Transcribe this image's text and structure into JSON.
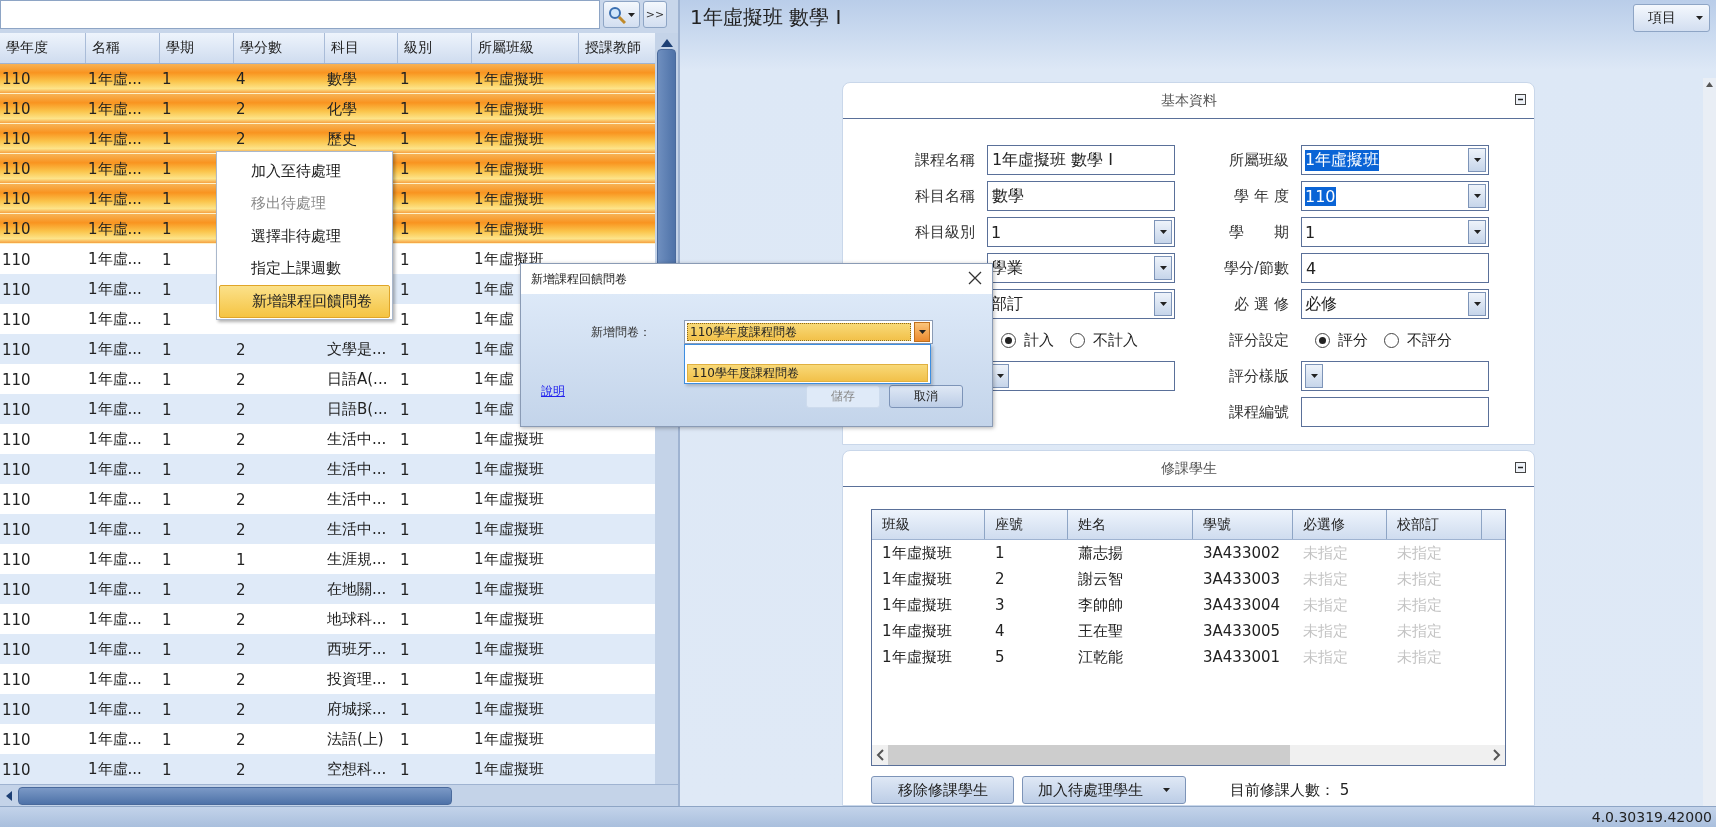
{
  "search": {
    "more_button": ">>"
  },
  "course_table": {
    "columns": [
      "學年度",
      "名稱",
      "學期",
      "學分數",
      "科目",
      "級別",
      "所屬班級",
      "授課教師"
    ],
    "rows": [
      {
        "year": "110",
        "name": "1年虛...",
        "term": "1",
        "credits": "4",
        "subject": "數學",
        "level": "1",
        "class": "1年虛擬班",
        "selected": true
      },
      {
        "year": "110",
        "name": "1年虛...",
        "term": "1",
        "credits": "2",
        "subject": "化學",
        "level": "1",
        "class": "1年虛擬班",
        "selected": true
      },
      {
        "year": "110",
        "name": "1年虛...",
        "term": "1",
        "credits": "2",
        "subject": "歷史",
        "level": "1",
        "class": "1年虛擬班",
        "selected": true
      },
      {
        "year": "110",
        "name": "1年虛...",
        "term": "1",
        "level": "1",
        "class": "1年虛擬班",
        "selected": true
      },
      {
        "year": "110",
        "name": "1年虛...",
        "term": "1",
        "level": "1",
        "class": "1年虛擬班",
        "selected": true
      },
      {
        "year": "110",
        "name": "1年虛...",
        "term": "1",
        "level": "1",
        "class": "1年虛擬班",
        "selected": true
      },
      {
        "year": "110",
        "name": "1年虛...",
        "term": "1",
        "level": "1",
        "class": "1年虛擬班",
        "selected": false
      },
      {
        "year": "110",
        "name": "1年虛...",
        "term": "1",
        "level": "1",
        "class": "1年虛",
        "selected": false
      },
      {
        "year": "110",
        "name": "1年虛...",
        "term": "1",
        "level": "1",
        "class": "1年虛",
        "selected": false
      },
      {
        "year": "110",
        "name": "1年虛...",
        "term": "1",
        "credits": "2",
        "subject": "文學是...",
        "level": "1",
        "class": "1年虛",
        "selected": false
      },
      {
        "year": "110",
        "name": "1年虛...",
        "term": "1",
        "credits": "2",
        "subject": "日語A(...",
        "level": "1",
        "class": "1年虛",
        "selected": false
      },
      {
        "year": "110",
        "name": "1年虛...",
        "term": "1",
        "credits": "2",
        "subject": "日語B(...",
        "level": "1",
        "class": "1年虛",
        "selected": false
      },
      {
        "year": "110",
        "name": "1年虛...",
        "term": "1",
        "credits": "2",
        "subject": "生活中...",
        "level": "1",
        "class": "1年虛擬班",
        "selected": false
      },
      {
        "year": "110",
        "name": "1年虛...",
        "term": "1",
        "credits": "2",
        "subject": "生活中...",
        "level": "1",
        "class": "1年虛擬班",
        "selected": false
      },
      {
        "year": "110",
        "name": "1年虛...",
        "term": "1",
        "credits": "2",
        "subject": "生活中...",
        "level": "1",
        "class": "1年虛擬班",
        "selected": false
      },
      {
        "year": "110",
        "name": "1年虛...",
        "term": "1",
        "credits": "2",
        "subject": "生活中...",
        "level": "1",
        "class": "1年虛擬班",
        "selected": false
      },
      {
        "year": "110",
        "name": "1年虛...",
        "term": "1",
        "credits": "1",
        "subject": "生涯規...",
        "level": "1",
        "class": "1年虛擬班",
        "selected": false
      },
      {
        "year": "110",
        "name": "1年虛...",
        "term": "1",
        "credits": "2",
        "subject": "在地關...",
        "level": "1",
        "class": "1年虛擬班",
        "selected": false
      },
      {
        "year": "110",
        "name": "1年虛...",
        "term": "1",
        "credits": "2",
        "subject": "地球科...",
        "level": "1",
        "class": "1年虛擬班",
        "selected": false
      },
      {
        "year": "110",
        "name": "1年虛...",
        "term": "1",
        "credits": "2",
        "subject": "西班牙...",
        "level": "1",
        "class": "1年虛擬班",
        "selected": false
      },
      {
        "year": "110",
        "name": "1年虛...",
        "term": "1",
        "credits": "2",
        "subject": "投資理...",
        "level": "1",
        "class": "1年虛擬班",
        "selected": false
      },
      {
        "year": "110",
        "name": "1年虛...",
        "term": "1",
        "credits": "2",
        "subject": "府城採...",
        "level": "1",
        "class": "1年虛擬班",
        "selected": false
      },
      {
        "year": "110",
        "name": "1年虛...",
        "term": "1",
        "credits": "2",
        "subject": "法語(上)",
        "level": "1",
        "class": "1年虛擬班",
        "selected": false
      },
      {
        "year": "110",
        "name": "1年虛...",
        "term": "1",
        "credits": "2",
        "subject": "空想科...",
        "level": "1",
        "class": "1年虛擬班",
        "selected": false
      }
    ]
  },
  "context_menu": {
    "items": [
      {
        "label": "加入至待處理",
        "disabled": false,
        "selected": false
      },
      {
        "label": "移出待處理",
        "disabled": true,
        "selected": false
      },
      {
        "label": "選擇非待處理",
        "disabled": false,
        "selected": false
      },
      {
        "label": "指定上課週數",
        "disabled": false,
        "selected": false
      },
      {
        "label": "新增課程回饋問卷",
        "disabled": false,
        "selected": true
      }
    ]
  },
  "dialog": {
    "title": "新增課程回饋問卷",
    "field_label": "新增問卷：",
    "value": "110學年度課程問卷",
    "options": [
      {
        "label": "110學年度課程問卷",
        "selected": true
      }
    ],
    "link": "說明",
    "buttons": [
      {
        "label": "儲存",
        "disabled": true
      },
      {
        "label": "取消",
        "disabled": false
      }
    ]
  },
  "course_title": "1年虛擬班  數學 I",
  "menu_button": "項目",
  "basic_info": {
    "title": "基本資料",
    "left_fields": [
      {
        "kind": "text",
        "label": "課程名稱",
        "value": "1年虛擬班 數學 I"
      },
      {
        "kind": "text",
        "label": "科目名稱",
        "value": "數學"
      },
      {
        "kind": "select",
        "label": "科目級別",
        "value": "1",
        "highlighted": false
      },
      {
        "kind": "select",
        "value": "學業",
        "highlighted": false
      },
      {
        "kind": "select",
        "value": "部訂",
        "highlighted": false
      },
      {
        "kind": "radio",
        "options": [
          {
            "label": "計入",
            "selected": true
          },
          {
            "label": "不計入",
            "selected": false
          }
        ]
      },
      {
        "kind": "select"
      }
    ],
    "right_fields": [
      {
        "kind": "select",
        "label": "所屬班級",
        "value": "1年虛擬班",
        "highlighted": true
      },
      {
        "kind": "select",
        "label": "學 年 度",
        "value": "110",
        "highlighted": true
      },
      {
        "kind": "select",
        "label": "學　　期",
        "value": "1",
        "highlighted": false
      },
      {
        "kind": "text",
        "label": "學分/節數",
        "value": "4"
      },
      {
        "kind": "select",
        "label": "必 選 修",
        "value": "必修",
        "highlighted": false
      },
      {
        "kind": "radio",
        "label": "評分設定",
        "options": [
          {
            "label": "評分",
            "selected": true
          },
          {
            "label": "不評分",
            "selected": false
          }
        ]
      },
      {
        "kind": "select",
        "label": "評分樣版"
      },
      {
        "kind": "text",
        "label": "課程編號"
      }
    ]
  },
  "students": {
    "title": "修課學生",
    "columns": [
      {
        "label": "班級",
        "muted": false
      },
      {
        "label": "座號",
        "muted": false
      },
      {
        "label": "姓名",
        "muted": false
      },
      {
        "label": "學號",
        "muted": false
      },
      {
        "label": "必選修",
        "muted": true
      },
      {
        "label": "校部訂",
        "muted": true
      }
    ],
    "rows": [
      [
        "1年虛擬班",
        "1",
        "蕭志揚",
        "3A433002",
        "未指定",
        "未指定"
      ],
      [
        "1年虛擬班",
        "2",
        "謝云智",
        "3A433003",
        "未指定",
        "未指定"
      ],
      [
        "1年虛擬班",
        "3",
        "李帥帥",
        "3A433004",
        "未指定",
        "未指定"
      ],
      [
        "1年虛擬班",
        "4",
        "王在聖",
        "3A433005",
        "未指定",
        "未指定"
      ],
      [
        "1年虛擬班",
        "5",
        "江乾能",
        "3A433001",
        "未指定",
        "未指定"
      ]
    ],
    "buttons": [
      {
        "label": "移除修課學生",
        "kind": "plain"
      },
      {
        "label": "加入待處理學生",
        "kind": "dropdown"
      }
    ],
    "count_label": "目前修課人數：",
    "count": "5"
  },
  "status_bar": "4.0.30319.42000"
}
